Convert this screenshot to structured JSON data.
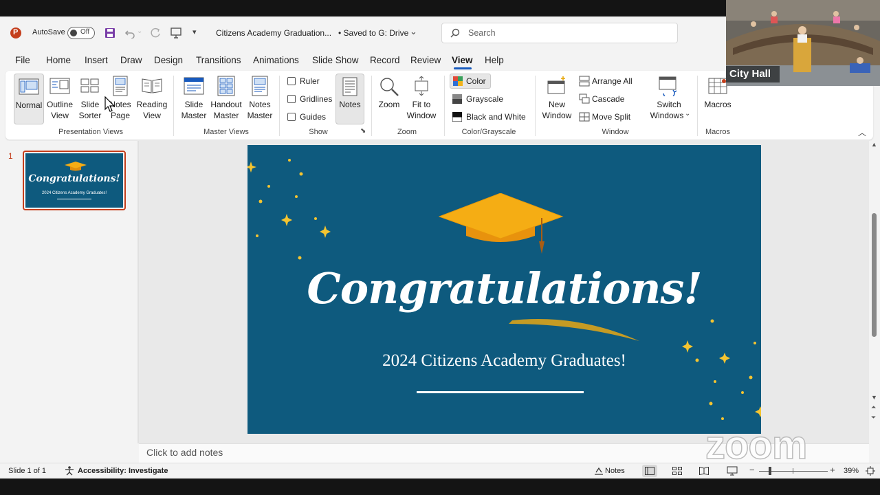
{
  "titlebar": {
    "autosave_label": "AutoSave",
    "autosave_state": "Off",
    "doc_title": "Citizens Academy Graduation...",
    "saved_status": "• Saved to G: Drive",
    "search_placeholder": "Search"
  },
  "menu_tabs": [
    "File",
    "Home",
    "Insert",
    "Draw",
    "Design",
    "Transitions",
    "Animations",
    "Slide Show",
    "Record",
    "Review",
    "View",
    "Help"
  ],
  "active_tab": "View",
  "ribbon": {
    "presentation_views": {
      "label": "Presentation Views",
      "buttons": [
        {
          "l1": "Normal",
          "l2": ""
        },
        {
          "l1": "Outline",
          "l2": "View"
        },
        {
          "l1": "Slide",
          "l2": "Sorter"
        },
        {
          "l1": "Notes",
          "l2": "Page"
        },
        {
          "l1": "Reading",
          "l2": "View"
        }
      ]
    },
    "master_views": {
      "label": "Master Views",
      "buttons": [
        {
          "l1": "Slide",
          "l2": "Master"
        },
        {
          "l1": "Handout",
          "l2": "Master"
        },
        {
          "l1": "Notes",
          "l2": "Master"
        }
      ]
    },
    "show": {
      "label": "Show",
      "checkboxes": [
        "Ruler",
        "Gridlines",
        "Guides"
      ],
      "notes_button": "Notes"
    },
    "zoom": {
      "label": "Zoom",
      "zoom_button": "Zoom",
      "fit_l1": "Fit to",
      "fit_l2": "Window"
    },
    "color": {
      "label": "Color/Grayscale",
      "options": [
        "Color",
        "Grayscale",
        "Black and White"
      ]
    },
    "window": {
      "label": "Window",
      "new_l1": "New",
      "new_l2": "Window",
      "options": [
        "Arrange All",
        "Cascade",
        "Move Split"
      ],
      "switch_l1": "Switch",
      "switch_l2": "Windows"
    },
    "macros": {
      "label": "Macros",
      "button": "Macros"
    }
  },
  "thumbnail": {
    "number": "1",
    "title": "Congratulations!",
    "subtitle": "2024 Citizens Academy Graduates!"
  },
  "slide": {
    "title": "Congratulations!",
    "subtitle": "2024 Citizens Academy Graduates!"
  },
  "notes_placeholder": "Click to add notes",
  "status": {
    "slide_count": "Slide 1 of 1",
    "accessibility": "Accessibility: Investigate",
    "notes": "Notes",
    "zoom": "39%"
  },
  "video": {
    "label": "City Hall",
    "watermark": "zoom"
  },
  "colors": {
    "accent": "#185abd",
    "slide_bg": "#0e5a7e",
    "cap_gold": "#f5ad14",
    "stars": "#f4c430"
  }
}
